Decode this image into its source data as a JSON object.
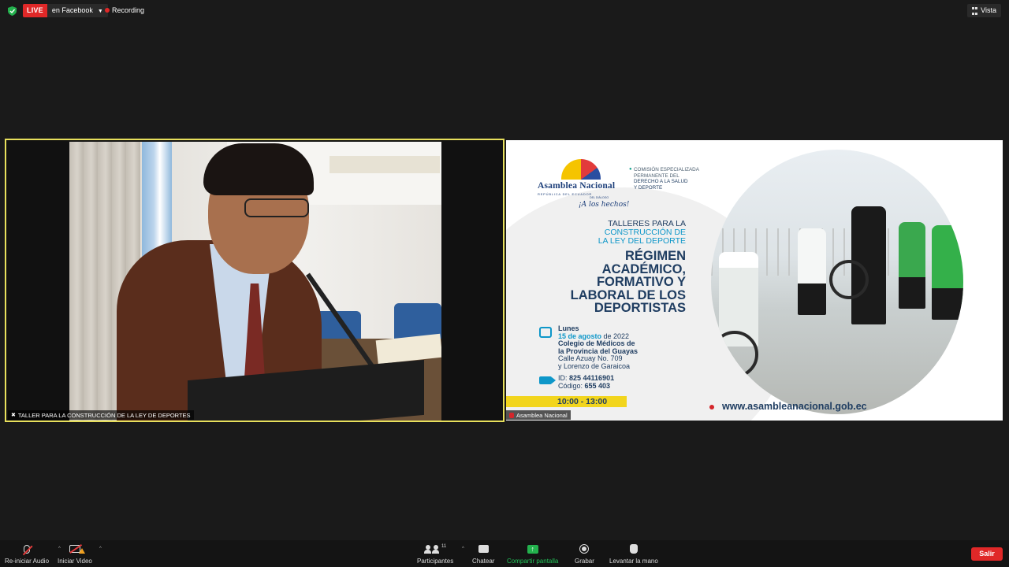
{
  "topbar": {
    "live_label": "LIVE",
    "stream_target": "en Facebook",
    "recording_label": "Recording",
    "view_label": "Vista",
    "colors": {
      "live": "#e02828",
      "security": "#23b14d"
    }
  },
  "tiles": {
    "speaker": {
      "name": "TALLER PARA LA CONSTRUCCIÓN DE LA  LEY DE DEPORTES",
      "active_speaker_border": "#e8e05c"
    },
    "share": {
      "name": "Asamblea Nacional"
    }
  },
  "slide": {
    "logo_name": "Asamblea Nacional",
    "logo_sub": "REPÚBLICA DEL ECUADOR",
    "slogan_pre": "DEL DIÁLOGO",
    "slogan": "¡A los hechos!",
    "commission_line1": "COMISIÓN ESPECIALIZADA",
    "commission_line2": "PERMANENTE DEL",
    "commission_line3": "DERECHO A LA SALUD",
    "commission_line4": "Y DEPORTE",
    "talleres_1": "TALLERES PARA LA",
    "talleres_2": "CONSTRUCCIÓN DE",
    "talleres_3": "LA LEY DEL DEPORTE",
    "regimen_1": "RÉGIMEN",
    "regimen_2": "ACADÉMICO,",
    "regimen_3": "FORMATIVO Y",
    "regimen_4": "LABORAL DE LOS",
    "regimen_5": "DEPORTISTAS",
    "day": "Lunes",
    "date": "15 de agosto",
    "date_suffix": " de 2022",
    "venue_1": "Colegio de Médicos de",
    "venue_2": "la Provincia del Guayas",
    "address_1": "Calle Azuay No. 709",
    "address_2": "y Lorenzo de Garaicoa",
    "id_label": "ID: ",
    "id_value": "825 44116901",
    "code_label": "Código: ",
    "code_value": "655 403",
    "hours": "10:00 - 13:00",
    "url": "www.asambleanacional.gob.ec",
    "colors": {
      "navy": "#1f3d61",
      "cyan": "#0e97c9",
      "yellow": "#f2d51d",
      "red": "#d4262b"
    }
  },
  "toolbar": {
    "audio_label": "Re-iniciar Audio",
    "video_label": "Iniciar Video",
    "participants_label": "Participantes",
    "participants_count": "11",
    "chat_label": "Chatear",
    "share_label": "Compartir pantalla",
    "record_label": "Grabar",
    "raise_hand_label": "Levantar la mano",
    "leave_label": "Salir",
    "icons": [
      "microphone-muted-icon",
      "video-off-icon",
      "participants-icon",
      "chat-icon",
      "share-screen-icon",
      "record-icon",
      "raise-hand-icon"
    ]
  }
}
